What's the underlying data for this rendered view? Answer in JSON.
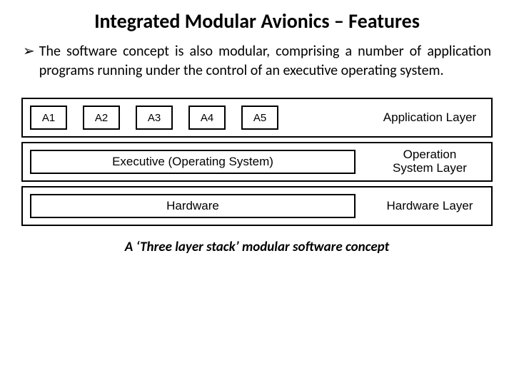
{
  "title": "Integrated Modular Avionics – Features",
  "bullet": {
    "arrow": "➢",
    "text": "The software concept is also modular, comprising a number of application programs running under the control of an executive operating system."
  },
  "diagram": {
    "apps": {
      "items": [
        "A1",
        "A2",
        "A3",
        "A4",
        "A5"
      ],
      "label": "Application Layer"
    },
    "exec": {
      "bar": "Executive (Operating System)",
      "label_line1": "Operation",
      "label_line2": "System Layer"
    },
    "hw": {
      "bar": "Hardware",
      "label": "Hardware Layer"
    }
  },
  "caption": "A ‘Three layer stack’ modular software concept"
}
